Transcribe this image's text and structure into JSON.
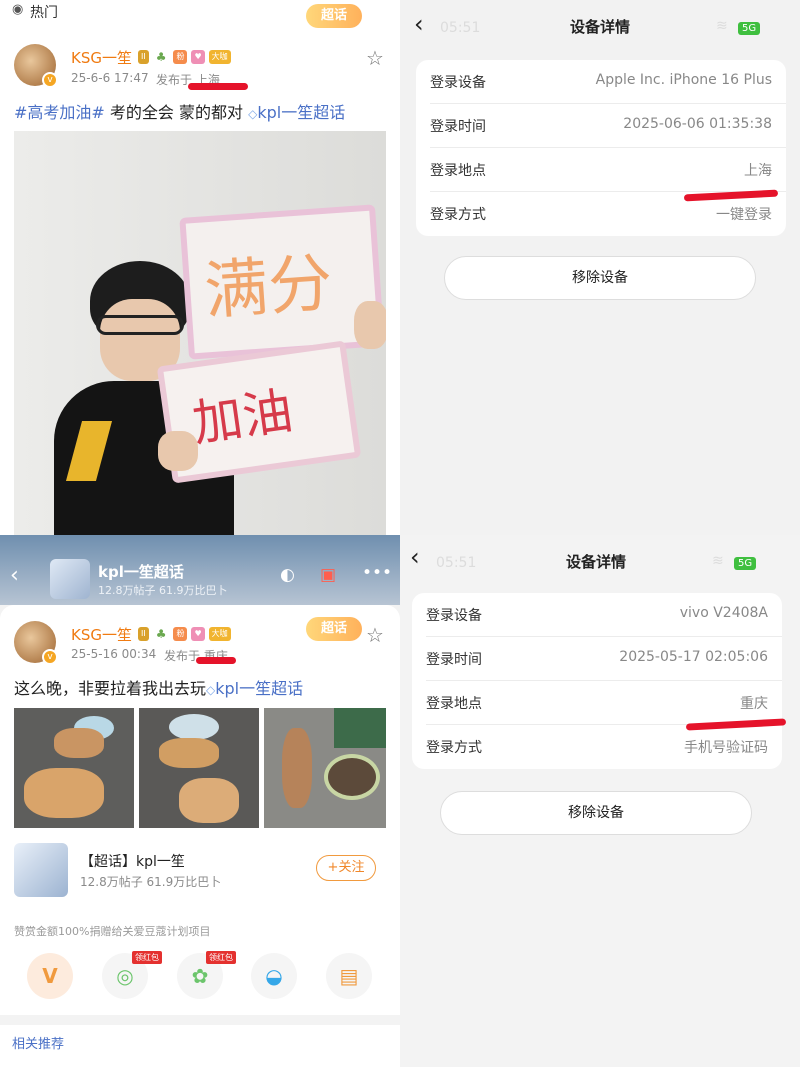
{
  "post1": {
    "hot_label": "热门",
    "chaohua_tag": "超话",
    "username": "KSG一笙",
    "badges": [
      "II",
      "粉",
      "大咖"
    ],
    "date": "25-6-6 17:47",
    "location": "发布于 上海",
    "text_tag": "#高考加油#",
    "text_body": " 考的全会 蒙的都对",
    "text_link": "kpl一笙超话",
    "sign_top": "满分",
    "sign_bottom": "加油"
  },
  "topic_bar": {
    "title": "kpl一笙超话",
    "stats": "12.8万帖子 61.9万比巴卜"
  },
  "post2": {
    "chaohua_tag": "超话",
    "username": "KSG一笙",
    "badges": [
      "II",
      "粉",
      "大咖"
    ],
    "date": "25-5-16 00:34",
    "location": "发布于 重庆",
    "text_body": "这么晚，非要拉着我出去玩",
    "text_link": "kpl一笙超话",
    "supertopic_name": "【超话】kpl一笙",
    "supertopic_stats": "12.8万帖子 61.9万比巴卜",
    "follow_label": "+关注",
    "donation_note": "赞赏金额100%捐赠给关爱豆蔻计划项目",
    "redpack_label_1": "领红包",
    "redpack_label_2": "领红包",
    "related_label": "相关推荐"
  },
  "device1": {
    "nav_title": "设备详情",
    "ghost_time": "05:51",
    "net": "5G",
    "rows": [
      {
        "label": "登录设备",
        "value": "Apple Inc. iPhone 16 Plus"
      },
      {
        "label": "登录时间",
        "value": "2025-06-06 01:35:38"
      },
      {
        "label": "登录地点",
        "value": "上海"
      },
      {
        "label": "登录方式",
        "value": "一键登录"
      }
    ],
    "remove_label": "移除设备"
  },
  "device2": {
    "nav_title": "设备详情",
    "ghost_time": "05:51",
    "net": "5G",
    "rows": [
      {
        "label": "登录设备",
        "value": "vivo V2408A"
      },
      {
        "label": "登录时间",
        "value": "2025-05-17 02:05:06"
      },
      {
        "label": "登录地点",
        "value": "重庆"
      },
      {
        "label": "登录方式",
        "value": "手机号验证码"
      }
    ],
    "remove_label": "移除设备"
  },
  "colors": {
    "username": "#f07b12",
    "link": "#4a70c6",
    "annotation_red": "#e5132a",
    "settings_bg": "#f2f2f2"
  }
}
